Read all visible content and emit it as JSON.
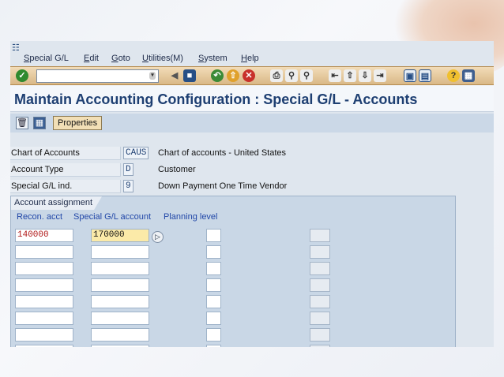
{
  "menu": {
    "items": [
      "Special G/L",
      "Edit",
      "Goto",
      "Utilities(M)",
      "System",
      "Help"
    ]
  },
  "toolbar": {
    "command_value": "",
    "icons": [
      "enter-icon",
      "save-icon",
      "back-icon",
      "exit-icon",
      "cancel-icon",
      "print-icon",
      "find-icon",
      "find-next-icon",
      "first-page-icon",
      "previous-page-icon",
      "next-page-icon",
      "last-page-icon",
      "new-session-icon",
      "shortcut-icon",
      "help-icon",
      "layout-menu-icon"
    ]
  },
  "title": "Maintain Accounting Configuration : Special G/L - Accounts",
  "app_toolbar": {
    "icons": [
      "delete-icon",
      "table-icon"
    ],
    "properties_label": "Properties"
  },
  "header_fields": [
    {
      "label": "Chart of Accounts",
      "value": "CAUS",
      "description": "Chart of accounts - United States"
    },
    {
      "label": "Account Type",
      "value": "D",
      "description": "Customer"
    },
    {
      "label": "Special G/L ind.",
      "value": "9",
      "description": "Down Payment One Time Vendor"
    }
  ],
  "account_assignment": {
    "tab_label": "Account assignment",
    "columns": [
      "Recon. acct",
      "Special G/L account",
      "Planning level"
    ],
    "rows": [
      {
        "recon": "140000",
        "special_gl": "170000"
      },
      {
        "recon": "",
        "special_gl": ""
      },
      {
        "recon": "",
        "special_gl": ""
      },
      {
        "recon": "",
        "special_gl": ""
      },
      {
        "recon": "",
        "special_gl": ""
      },
      {
        "recon": "",
        "special_gl": ""
      },
      {
        "recon": "",
        "special_gl": ""
      },
      {
        "recon": "",
        "special_gl": ""
      }
    ]
  }
}
